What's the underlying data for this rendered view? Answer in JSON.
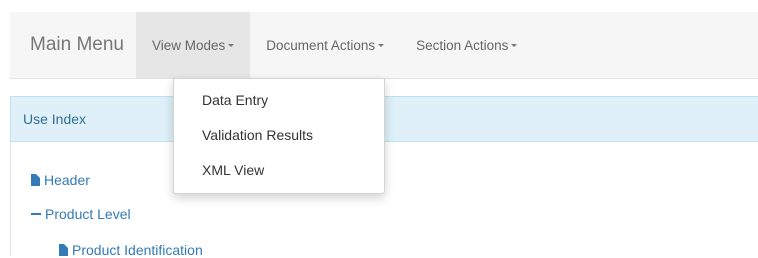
{
  "navbar": {
    "brand": "Main Menu",
    "items": [
      {
        "label": "View Modes",
        "active": true
      },
      {
        "label": "Document Actions",
        "active": false
      },
      {
        "label": "Section Actions",
        "active": false
      }
    ]
  },
  "dropdown": {
    "items": [
      "Data Entry",
      "Validation Results",
      "XML View"
    ]
  },
  "panel": {
    "heading": "Use Index"
  },
  "tree": {
    "items": [
      {
        "label": "Header",
        "icon": "file-icon"
      },
      {
        "label": "Product Level",
        "icon": "minus-icon"
      },
      {
        "label": "Product Identification",
        "icon": "file-icon"
      }
    ]
  },
  "colors": {
    "link": "#337ab7",
    "panel_heading_bg": "#dff0f9",
    "navbar_bg": "#f6f6f6"
  }
}
